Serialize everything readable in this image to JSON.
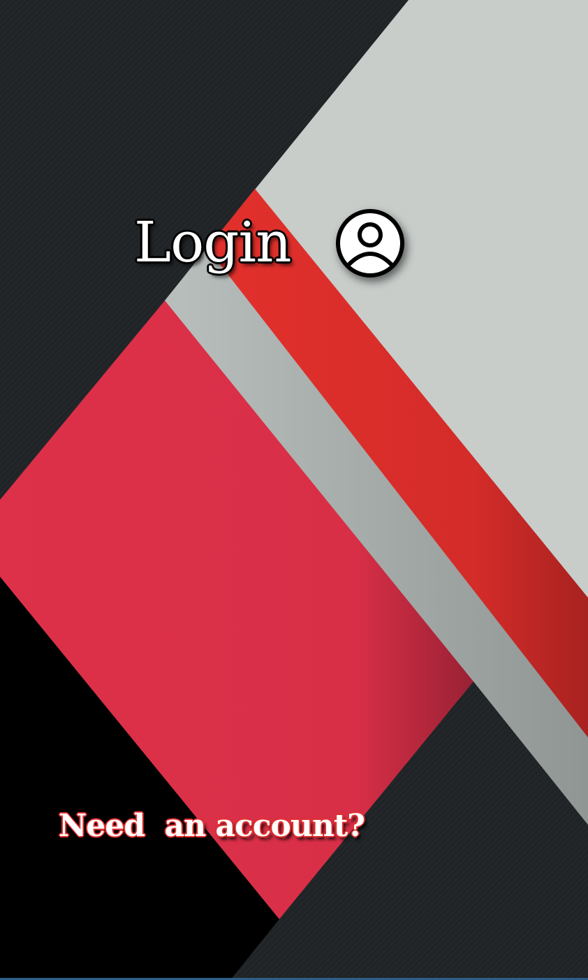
{
  "login": {
    "title": "Login"
  },
  "signup_link": {
    "label": "Need  an account?"
  },
  "icons": {
    "user": "user-circle-icon"
  },
  "colors": {
    "dark": "#1f2326",
    "black": "#000000",
    "light_gray": "#c8cdca",
    "red": "#dd312d",
    "crimson": "#dd3049",
    "link_outline": "#e0312f"
  }
}
